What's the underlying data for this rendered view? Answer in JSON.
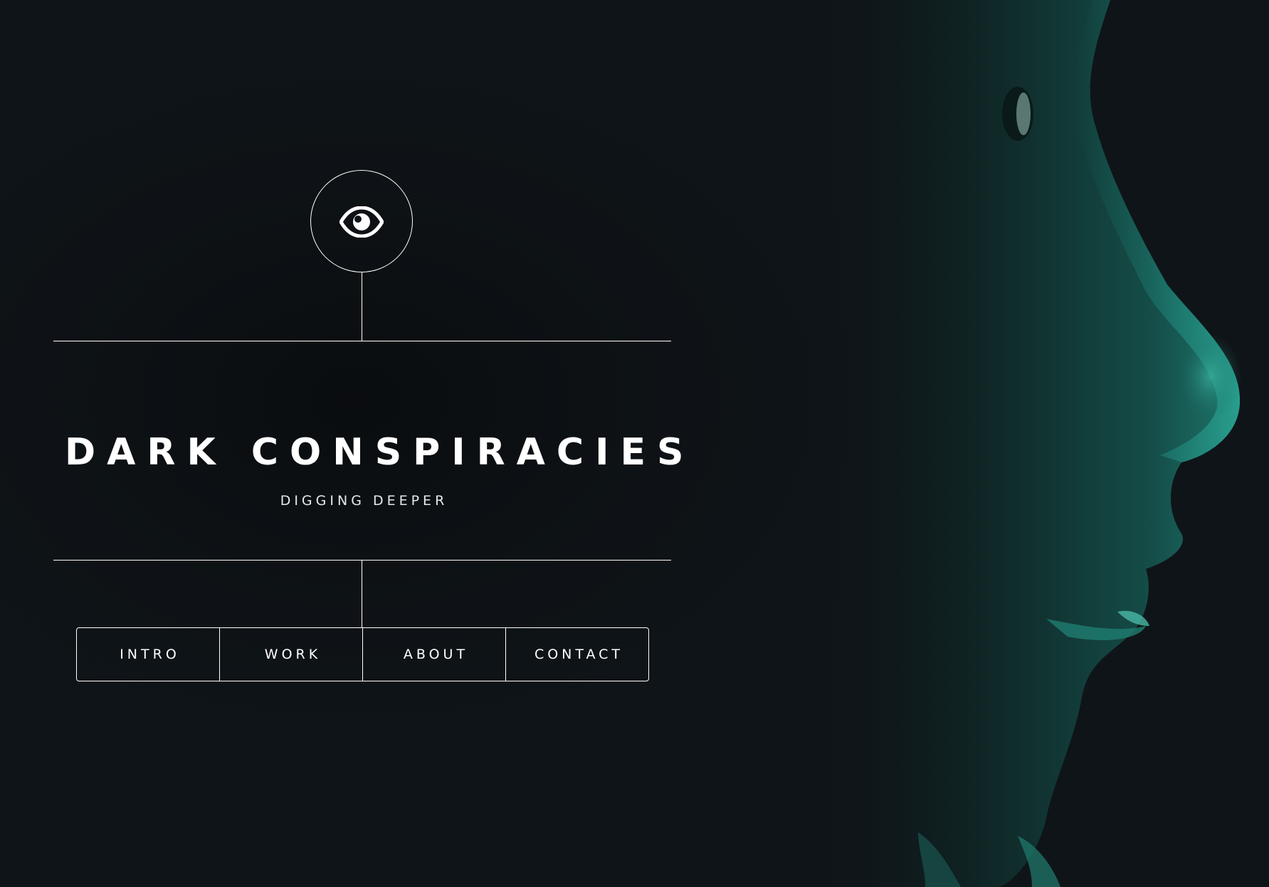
{
  "site": {
    "logo_icon": "eye-icon",
    "title": "DARK CONSPIRACIES",
    "subtitle": "DIGGING DEEPER"
  },
  "nav": {
    "items": [
      {
        "label": "INTRO"
      },
      {
        "label": "WORK"
      },
      {
        "label": "ABOUT"
      },
      {
        "label": "CONTACT"
      }
    ]
  },
  "colors": {
    "background": "#0f1418",
    "accent_teal": "#1f8f82",
    "foreground": "#ffffff"
  }
}
